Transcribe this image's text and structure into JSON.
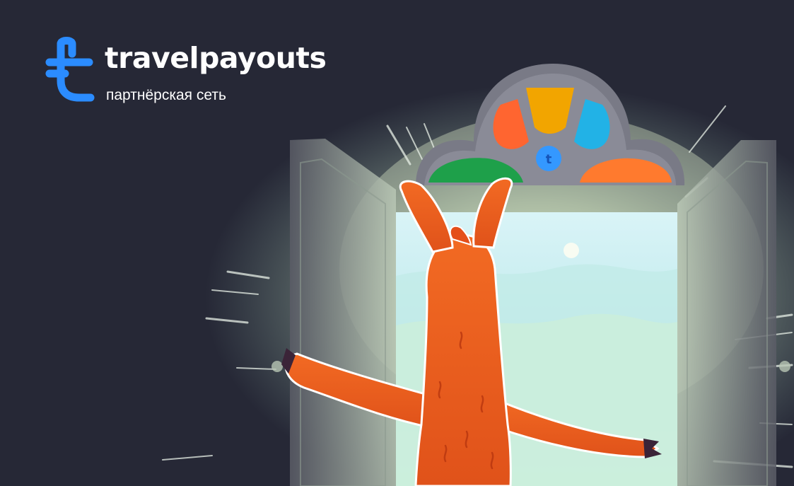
{
  "brand": {
    "name": "travelpayouts",
    "tagline": "партнёрская сеть",
    "accent": "#2b8cff"
  },
  "illustration": {
    "subject": "llama-character-opening-door",
    "background": "#262836",
    "window_colors": [
      "#ff6a2b",
      "#f5a600",
      "#21b4e8",
      "#1fa24a",
      "#ff7a30"
    ],
    "character_color": "#f05a1c",
    "sky_color": "#cfeff3"
  }
}
